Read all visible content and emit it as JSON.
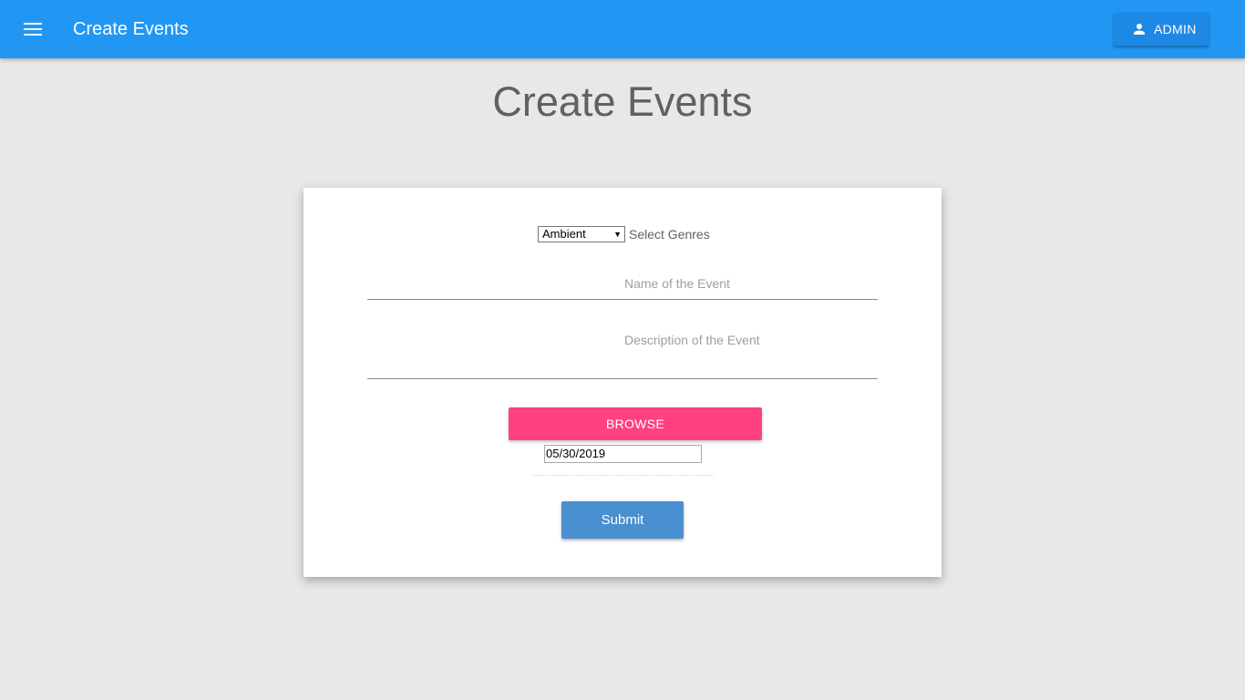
{
  "topbar": {
    "menu_icon": "hamburger-menu-icon",
    "title": "Create Events",
    "admin_icon": "person-icon",
    "admin_label": "ADMIN",
    "color": "#2196f3"
  },
  "page": {
    "title": "Create Events",
    "background": "#e8e8e8"
  },
  "form": {
    "genre": {
      "selected": "Ambient",
      "label": "Select Genres"
    },
    "name_placeholder": "Name of the Event",
    "description_placeholder": "Description of the Event",
    "browse_label": "BROWSE",
    "browse_color": "#ff4081",
    "date_value": "05/30/2019",
    "submit_label": "Submit",
    "submit_color": "#4a8fd0"
  }
}
